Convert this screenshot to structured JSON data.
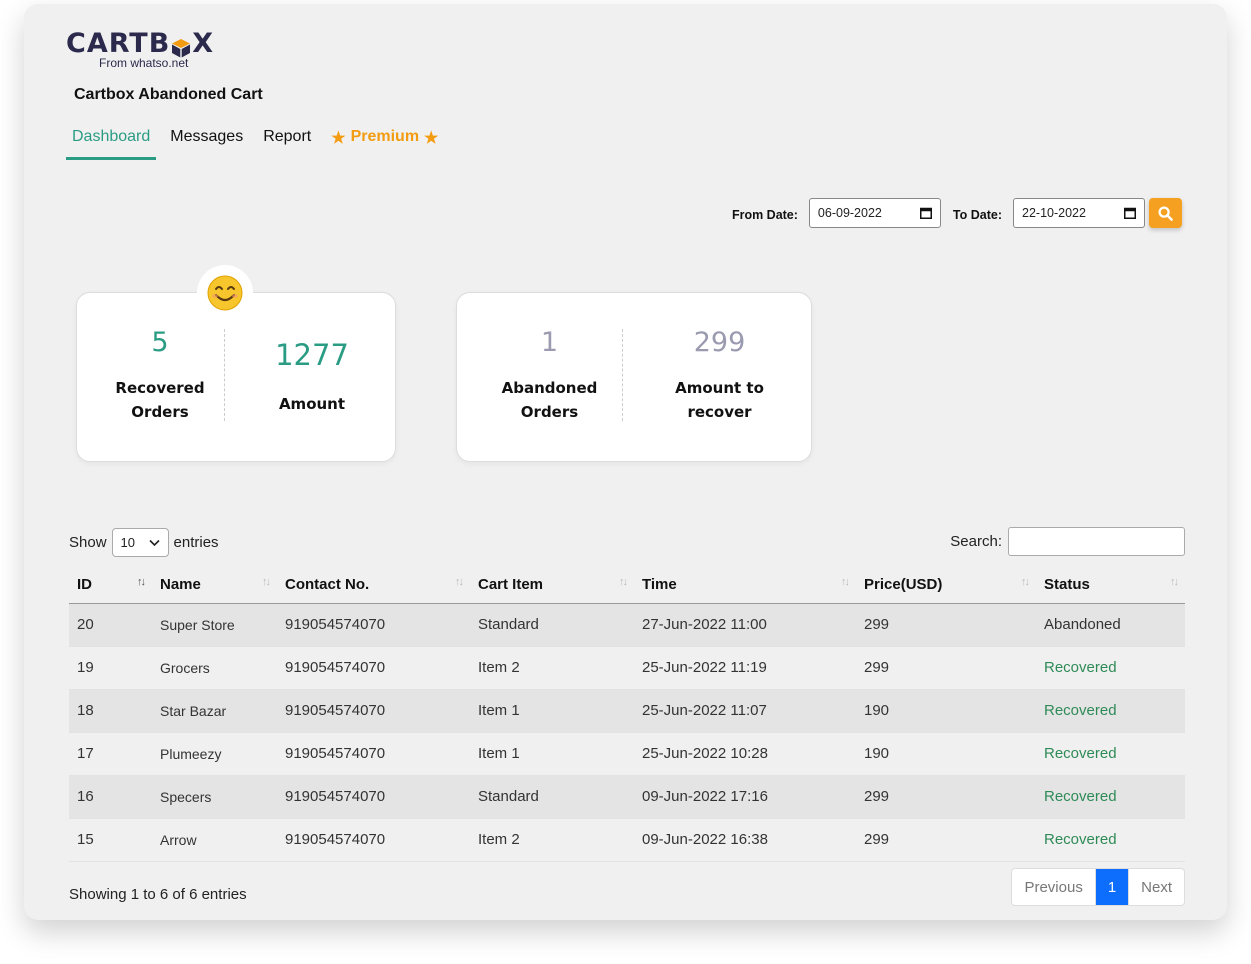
{
  "brand": {
    "name_pre": "CARTB",
    "name_post": "X",
    "subtitle": "From whatso.net"
  },
  "app_title": "Cartbox Abandoned Cart",
  "nav": {
    "dashboard": "Dashboard",
    "messages": "Messages",
    "report": "Report",
    "premium": "Premium"
  },
  "filters": {
    "from_label": "From Date:",
    "from_value": "06-09-2022",
    "to_label": "To Date:",
    "to_value": "22-10-2022"
  },
  "cards": {
    "recovered_orders": {
      "value": "5",
      "label_line1": "Recovered",
      "label_line2": "Orders"
    },
    "recovered_amount": {
      "value": "1277",
      "label": "Amount"
    },
    "abandoned_orders": {
      "value": "1",
      "label_line1": "Abandoned",
      "label_line2": "Orders"
    },
    "amount_to_recover": {
      "value": "299",
      "label_line1": "Amount to",
      "label_line2": "recover"
    }
  },
  "table_controls": {
    "show_label": "Show",
    "entries_value": "10",
    "entries_label": "entries",
    "search_label": "Search:"
  },
  "table": {
    "columns": [
      "ID",
      "Name",
      "Contact No.",
      "Cart Item",
      "Time",
      "Price(USD)",
      "Status"
    ],
    "rows": [
      [
        "20",
        "Super Store",
        "919054574070",
        "Standard",
        "27-Jun-2022 11:00",
        "299",
        "Abandoned"
      ],
      [
        "19",
        "Grocers",
        "919054574070",
        "Item 2",
        "25-Jun-2022 11:19",
        "299",
        "Recovered"
      ],
      [
        "18",
        "Star Bazar",
        "919054574070",
        "Item 1",
        "25-Jun-2022 11:07",
        "190",
        "Recovered"
      ],
      [
        "17",
        "Plumeezy",
        "919054574070",
        "Item 1",
        "25-Jun-2022 10:28",
        "190",
        "Recovered"
      ],
      [
        "16",
        "Specers",
        "919054574070",
        "Standard",
        "09-Jun-2022 17:16",
        "299",
        "Recovered"
      ],
      [
        "15",
        "Arrow",
        "919054574070",
        "Item 2",
        "09-Jun-2022 16:38",
        "299",
        "Recovered"
      ]
    ]
  },
  "footer": {
    "info": "Showing 1 to 6 of 6 entries",
    "previous": "Previous",
    "page": "1",
    "next": "Next"
  },
  "colors": {
    "accent_green": "#2b9c84",
    "premium_orange": "#f39c12",
    "search_button": "#f5a020",
    "page_active": "#0d6efd"
  },
  "icons": {
    "search": "search-icon",
    "calendar": "calendar-icon",
    "star": "star-icon",
    "smiley": "smiley-emoji-icon",
    "logo_box": "cube-icon"
  }
}
